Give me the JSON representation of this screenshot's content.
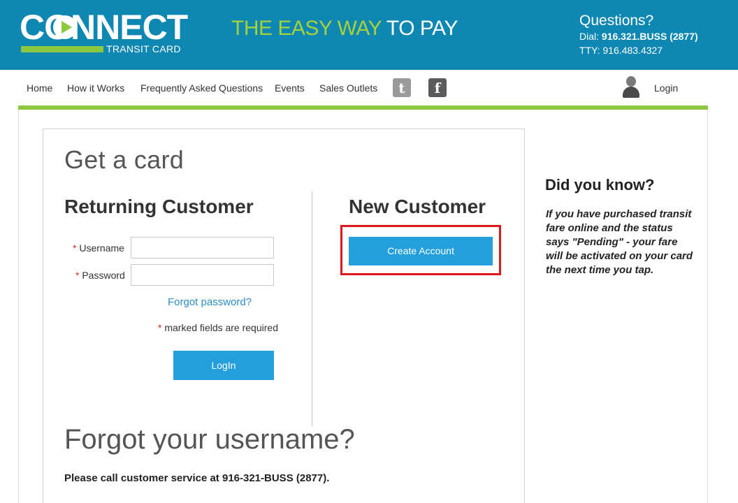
{
  "header": {
    "logo": {
      "word": "CONNECT",
      "sub": "TRANSIT CARD"
    },
    "tagline_part1": "THE EASY WAY",
    "tagline_part2": "TO PAY",
    "questions_title": "Questions?",
    "dial_label": "Dial:",
    "dial_number": "916.321.BUSS (2877)",
    "tty_text": "TTY: 916.483.4327",
    "colors": {
      "bar": "#0e88b2",
      "accent": "#8dc63f"
    }
  },
  "nav": {
    "items": [
      {
        "label": "Home"
      },
      {
        "label": "How it Works"
      },
      {
        "label": "Frequently Asked Questions"
      },
      {
        "label": "Events"
      },
      {
        "label": "Sales Outlets"
      }
    ],
    "twitter_icon": "twitter-icon",
    "facebook_icon": "facebook-icon",
    "user_icon": "user-icon",
    "login_label": "Login"
  },
  "main": {
    "title": "Get a card",
    "returning": {
      "heading": "Returning Customer",
      "username_label": "Username",
      "username_value": "",
      "password_label": "Password",
      "password_value": "",
      "required_mark": "*",
      "forgot_password": "Forgot password?",
      "required_note": "marked fields are required",
      "login_button": "LogIn"
    },
    "new_customer": {
      "heading": "New Customer",
      "create_button": "Create Account"
    },
    "forgot_username": {
      "heading": "Forgot your username?",
      "text": "Please call customer service at 916-321-BUSS (2877)."
    }
  },
  "sidebar": {
    "title": "Did you know?",
    "text": "If you have purchased transit fare online and the status says \"Pending\" - your fare will be activated on your card the next time you tap."
  },
  "highlight": {
    "color": "#e0161e",
    "target": "Create Account"
  }
}
